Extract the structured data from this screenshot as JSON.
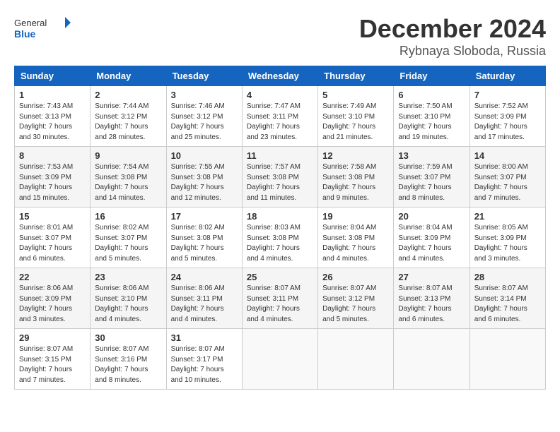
{
  "header": {
    "logo_general": "General",
    "logo_blue": "Blue",
    "month_title": "December 2024",
    "location": "Rybnaya Sloboda, Russia"
  },
  "days_of_week": [
    "Sunday",
    "Monday",
    "Tuesday",
    "Wednesday",
    "Thursday",
    "Friday",
    "Saturday"
  ],
  "weeks": [
    [
      {
        "day": 1,
        "info": "Sunrise: 7:43 AM\nSunset: 3:13 PM\nDaylight: 7 hours\nand 30 minutes."
      },
      {
        "day": 2,
        "info": "Sunrise: 7:44 AM\nSunset: 3:12 PM\nDaylight: 7 hours\nand 28 minutes."
      },
      {
        "day": 3,
        "info": "Sunrise: 7:46 AM\nSunset: 3:12 PM\nDaylight: 7 hours\nand 25 minutes."
      },
      {
        "day": 4,
        "info": "Sunrise: 7:47 AM\nSunset: 3:11 PM\nDaylight: 7 hours\nand 23 minutes."
      },
      {
        "day": 5,
        "info": "Sunrise: 7:49 AM\nSunset: 3:10 PM\nDaylight: 7 hours\nand 21 minutes."
      },
      {
        "day": 6,
        "info": "Sunrise: 7:50 AM\nSunset: 3:10 PM\nDaylight: 7 hours\nand 19 minutes."
      },
      {
        "day": 7,
        "info": "Sunrise: 7:52 AM\nSunset: 3:09 PM\nDaylight: 7 hours\nand 17 minutes."
      }
    ],
    [
      {
        "day": 8,
        "info": "Sunrise: 7:53 AM\nSunset: 3:09 PM\nDaylight: 7 hours\nand 15 minutes."
      },
      {
        "day": 9,
        "info": "Sunrise: 7:54 AM\nSunset: 3:08 PM\nDaylight: 7 hours\nand 14 minutes."
      },
      {
        "day": 10,
        "info": "Sunrise: 7:55 AM\nSunset: 3:08 PM\nDaylight: 7 hours\nand 12 minutes."
      },
      {
        "day": 11,
        "info": "Sunrise: 7:57 AM\nSunset: 3:08 PM\nDaylight: 7 hours\nand 11 minutes."
      },
      {
        "day": 12,
        "info": "Sunrise: 7:58 AM\nSunset: 3:08 PM\nDaylight: 7 hours\nand 9 minutes."
      },
      {
        "day": 13,
        "info": "Sunrise: 7:59 AM\nSunset: 3:07 PM\nDaylight: 7 hours\nand 8 minutes."
      },
      {
        "day": 14,
        "info": "Sunrise: 8:00 AM\nSunset: 3:07 PM\nDaylight: 7 hours\nand 7 minutes."
      }
    ],
    [
      {
        "day": 15,
        "info": "Sunrise: 8:01 AM\nSunset: 3:07 PM\nDaylight: 7 hours\nand 6 minutes."
      },
      {
        "day": 16,
        "info": "Sunrise: 8:02 AM\nSunset: 3:07 PM\nDaylight: 7 hours\nand 5 minutes."
      },
      {
        "day": 17,
        "info": "Sunrise: 8:02 AM\nSunset: 3:08 PM\nDaylight: 7 hours\nand 5 minutes."
      },
      {
        "day": 18,
        "info": "Sunrise: 8:03 AM\nSunset: 3:08 PM\nDaylight: 7 hours\nand 4 minutes."
      },
      {
        "day": 19,
        "info": "Sunrise: 8:04 AM\nSunset: 3:08 PM\nDaylight: 7 hours\nand 4 minutes."
      },
      {
        "day": 20,
        "info": "Sunrise: 8:04 AM\nSunset: 3:09 PM\nDaylight: 7 hours\nand 4 minutes."
      },
      {
        "day": 21,
        "info": "Sunrise: 8:05 AM\nSunset: 3:09 PM\nDaylight: 7 hours\nand 3 minutes."
      }
    ],
    [
      {
        "day": 22,
        "info": "Sunrise: 8:06 AM\nSunset: 3:09 PM\nDaylight: 7 hours\nand 3 minutes."
      },
      {
        "day": 23,
        "info": "Sunrise: 8:06 AM\nSunset: 3:10 PM\nDaylight: 7 hours\nand 4 minutes."
      },
      {
        "day": 24,
        "info": "Sunrise: 8:06 AM\nSunset: 3:11 PM\nDaylight: 7 hours\nand 4 minutes."
      },
      {
        "day": 25,
        "info": "Sunrise: 8:07 AM\nSunset: 3:11 PM\nDaylight: 7 hours\nand 4 minutes."
      },
      {
        "day": 26,
        "info": "Sunrise: 8:07 AM\nSunset: 3:12 PM\nDaylight: 7 hours\nand 5 minutes."
      },
      {
        "day": 27,
        "info": "Sunrise: 8:07 AM\nSunset: 3:13 PM\nDaylight: 7 hours\nand 6 minutes."
      },
      {
        "day": 28,
        "info": "Sunrise: 8:07 AM\nSunset: 3:14 PM\nDaylight: 7 hours\nand 6 minutes."
      }
    ],
    [
      {
        "day": 29,
        "info": "Sunrise: 8:07 AM\nSunset: 3:15 PM\nDaylight: 7 hours\nand 7 minutes."
      },
      {
        "day": 30,
        "info": "Sunrise: 8:07 AM\nSunset: 3:16 PM\nDaylight: 7 hours\nand 8 minutes."
      },
      {
        "day": 31,
        "info": "Sunrise: 8:07 AM\nSunset: 3:17 PM\nDaylight: 7 hours\nand 10 minutes."
      },
      null,
      null,
      null,
      null
    ]
  ]
}
